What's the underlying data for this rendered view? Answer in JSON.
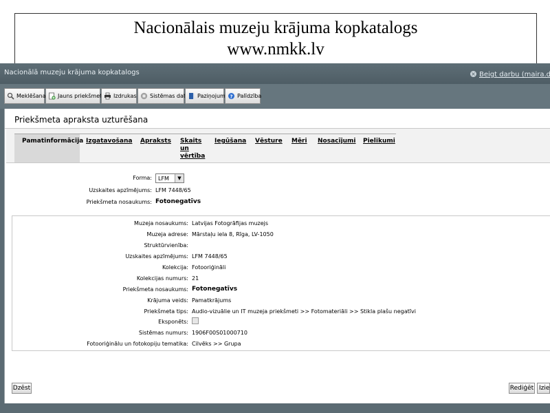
{
  "slide": {
    "title": "Nacionālais muzeju krājuma kopkatalogs",
    "url": "www.nmkk.lv"
  },
  "app": {
    "title": "Nacionālā muzeju krājuma kopkatalogs",
    "logout": "Beigt darbu (maira.dudare"
  },
  "toolbar": {
    "search": "Meklēšana",
    "new_item": "Jauns priekšmets",
    "print": "Izdrukas",
    "system_data": "Sistēmas dati",
    "notices": "Paziņojumi",
    "help": "Palīdzība"
  },
  "panel": {
    "title": "Priekšmeta apraksta uzturēšana"
  },
  "tabs": [
    {
      "label": "Pamatinformācija"
    },
    {
      "label": "Izgatavošana"
    },
    {
      "label": "Apraksts"
    },
    {
      "label_lines": [
        "Skaits",
        "un",
        "vērtība"
      ]
    },
    {
      "label": "Iegūšana"
    },
    {
      "label": "Vēsture"
    },
    {
      "label": "Mēri"
    },
    {
      "label": "Nosacījumi"
    },
    {
      "label": "Pielikumi"
    }
  ],
  "form": {
    "form_label": "Forma:",
    "form_value": "LFM",
    "acc_label": "Uzskaites apzīmējums:",
    "acc_value": "LFM 7448/65",
    "name_label": "Priekšmeta nosaukums:",
    "name_value": "Fotonegatīvs"
  },
  "details": [
    {
      "label": "Muzeja nosaukums:",
      "value": "Latvijas Fotogrāfijas muzejs"
    },
    {
      "label": "Muzeja adrese:",
      "value": "Mārstaļu iela 8, Rīga, LV-1050"
    },
    {
      "label": "Struktūrvienība:",
      "value": ""
    },
    {
      "label": "Uzskaites apzīmējums:",
      "value": "LFM 7448/65"
    },
    {
      "label": "Kolekcija:",
      "value": "Fotooriģināli"
    },
    {
      "label": "Kolekcijas numurs:",
      "value": "21"
    },
    {
      "label": "Priekšmeta nosaukums:",
      "value": "Fotonegatīvs"
    },
    {
      "label": "Krājuma veids:",
      "value": "Pamatkrājums"
    },
    {
      "label": "Priekšmeta tips:",
      "value": "Audio-vizuālie un IT muzeja priekšmeti >> Fotomateriāli >> Stikla plašu negatīvi"
    },
    {
      "label": "Eksponēts:",
      "value": ""
    },
    {
      "label": "Sistēmas numurs:",
      "value": "1906F00S01000710"
    },
    {
      "label": "Fotooriģinālu un fotokopiju tematika:",
      "value": "Cilvēks >> Grupa"
    }
  ],
  "buttons": {
    "delete": "Dzēst",
    "edit": "Rediģēt",
    "exit": "Iziet"
  }
}
